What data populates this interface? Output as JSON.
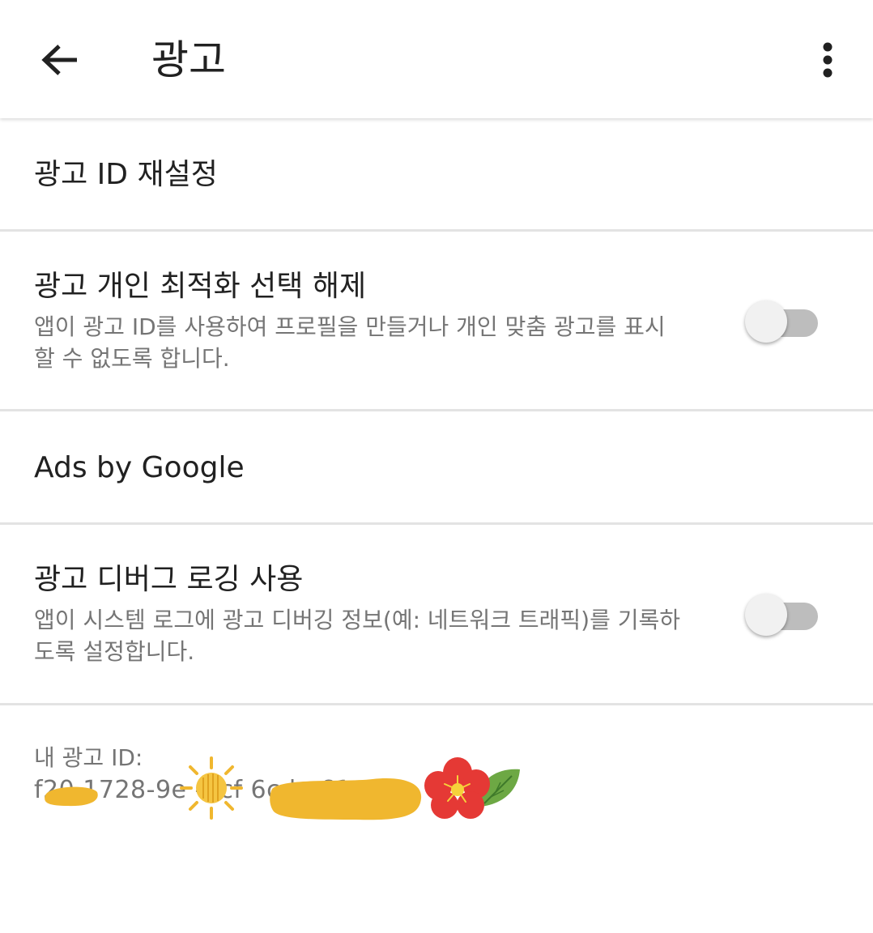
{
  "appbar": {
    "title": "광고",
    "back_icon": "arrow-back-icon",
    "more_icon": "more-vert-icon"
  },
  "items": [
    {
      "title": "광고 ID 재설정"
    },
    {
      "title": "광고 개인 최적화 선택 해제",
      "summary": "앱이 광고 ID를 사용하여 프로필을 만들거나 개인 맞춤 광고를 표시할 수 없도록 합니다.",
      "toggle_on": false
    },
    {
      "title": "Ads by Google"
    },
    {
      "title": "광고 디버그 로깅 사용",
      "summary": "앱이 시스템 로그에 광고 디버깅 정보(예: 네트워크 트래픽)를 기록하도록 설정합니다.",
      "toggle_on": false
    }
  ],
  "ad_id": {
    "label": "내 광고 ID:",
    "value": "f20 1728-9e  -4cf        6cd      e61"
  },
  "colors": {
    "text_primary": "#212121",
    "text_secondary": "#757575",
    "divider": "#e3e3e3",
    "switch_track_off": "#bdbdbd",
    "switch_thumb_off": "#f1f1f1",
    "redaction": "#f0b72f"
  }
}
